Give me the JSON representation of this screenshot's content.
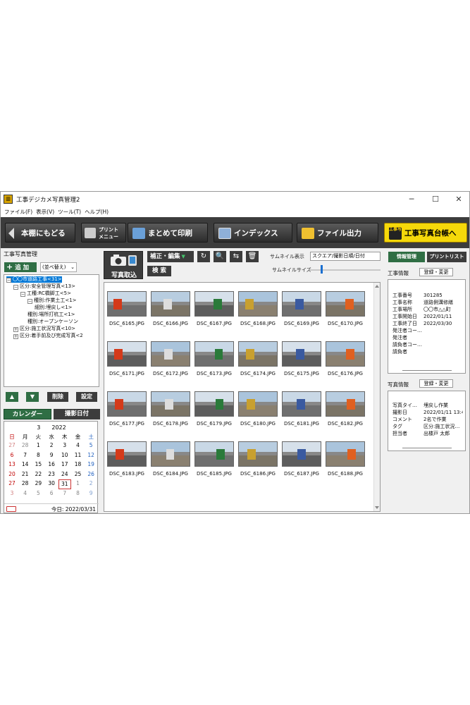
{
  "window": {
    "title": "工事デジカメ写真管理2",
    "minimize": "─",
    "maximize": "☐",
    "close": "✕"
  },
  "menu": [
    "ファイル(F)",
    "表示(V)",
    "ツール(T)",
    "ヘルプ(H)"
  ],
  "toolbar": {
    "back": "本棚にもどる",
    "print_menu_line1": "プリント",
    "print_menu_line2": "メニュー",
    "bulk_print": "まとめて印刷",
    "index": "インデックス",
    "file_output": "ファイル出力",
    "ledger": "工事写真台帳へ",
    "ledger_icon_text": "工事写真"
  },
  "left": {
    "section_title": "工事写真管理",
    "add_button": "追 加",
    "sort_select": "(並べ替え)",
    "tree": [
      {
        "label": "〇〇市道路工事<31>",
        "indent": 0,
        "toggle": "⊟",
        "selected": true
      },
      {
        "label": "区分:安全管理写真<13>",
        "indent": 1,
        "toggle": "⊟"
      },
      {
        "label": "工種:RC橋脚工<5>",
        "indent": 2,
        "toggle": "⊟"
      },
      {
        "label": "種別:作業土工<1>",
        "indent": 3,
        "toggle": "⊟"
      },
      {
        "label": "細別:埋戻し<1>",
        "indent": 4,
        "toggle": ""
      },
      {
        "label": "種別:場所打杭工<1>",
        "indent": 3,
        "toggle": ""
      },
      {
        "label": "種別:オープンケーソン",
        "indent": 3,
        "toggle": ""
      },
      {
        "label": "区分:施工状況写真<10>",
        "indent": 1,
        "toggle": "⊞"
      },
      {
        "label": "区分:着手前及び完成写真<2",
        "indent": 1,
        "toggle": "⊞"
      }
    ],
    "up_button": "▲",
    "down_button": "▼",
    "delete_button": "削除",
    "settings_button": "設定",
    "calendar_tab": "カレンダー",
    "shoot_date_tab": "撮影日付",
    "calendar": {
      "month": "3",
      "year": "2022",
      "weekdays": [
        "日",
        "月",
        "火",
        "水",
        "木",
        "金",
        "土"
      ],
      "weeks": [
        [
          "27",
          "28",
          "1",
          "2",
          "3",
          "4",
          "5"
        ],
        [
          "6",
          "7",
          "8",
          "9",
          "10",
          "11",
          "12"
        ],
        [
          "13",
          "14",
          "15",
          "16",
          "17",
          "18",
          "19"
        ],
        [
          "20",
          "21",
          "22",
          "23",
          "24",
          "25",
          "26"
        ],
        [
          "27",
          "28",
          "29",
          "30",
          "31",
          "1",
          "2"
        ],
        [
          "3",
          "4",
          "5",
          "6",
          "7",
          "8",
          "9"
        ]
      ],
      "today_label": "今日: 2022/03/31"
    }
  },
  "middle": {
    "import_button": "写真取込",
    "edit_button": "補正・編集",
    "search_button": "検 索",
    "thumb_mode_label": "サムネイル表示",
    "thumb_mode_value": "スクエア/撮影日順/日付",
    "thumb_size_label": "サムネイルサイズ",
    "thumb_size_level": 0.15,
    "thumbnails": [
      "DSC_6165.JPG",
      "DSC_6166.JPG",
      "DSC_6167.JPG",
      "DSC_6168.JPG",
      "DSC_6169.JPG",
      "DSC_6170.JPG",
      "DSC_6171.JPG",
      "DSC_6172.JPG",
      "DSC_6173.JPG",
      "DSC_6174.JPG",
      "DSC_6175.JPG",
      "DSC_6176.JPG",
      "DSC_6177.JPG",
      "DSC_6178.JPG",
      "DSC_6179.JPG",
      "DSC_6180.JPG",
      "DSC_6181.JPG",
      "DSC_6182.JPG",
      "DSC_6183.JPG",
      "DSC_6184.JPG",
      "DSC_6185.JPG",
      "DSC_6186.JPG",
      "DSC_6187.JPG",
      "DSC_6188.JPG"
    ]
  },
  "right": {
    "tab_info": "情報管理",
    "tab_printlist": "プリントリスト",
    "work_info_title": "工事情報",
    "work_info_button": "登録・変更",
    "work_info": [
      {
        "k": "工事番号",
        "v": "301285"
      },
      {
        "k": "工事名称",
        "v": "道路側溝修繕"
      },
      {
        "k": "工事場所",
        "v": "〇〇市△△町"
      },
      {
        "k": "工事開始日",
        "v": "2022/01/11"
      },
      {
        "k": "工事終了日",
        "v": "2022/03/30"
      },
      {
        "k": "発注者コー…",
        "v": ""
      },
      {
        "k": "発注者",
        "v": ""
      },
      {
        "k": "請負者コー…",
        "v": ""
      },
      {
        "k": "請負者",
        "v": ""
      }
    ],
    "photo_info_title": "写真情報",
    "photo_info_button": "登録・変更",
    "photo_info": [
      {
        "k": "写真タイ…",
        "v": "埋戻し作業"
      },
      {
        "k": "撮影日",
        "v": "2022/01/11 13:4"
      },
      {
        "k": "コメント",
        "v": "2名で作業"
      },
      {
        "k": "タグ",
        "v": "区分:施工状況…"
      },
      {
        "k": "担当者",
        "v": "出楼戸 太郎"
      }
    ]
  },
  "colors": {
    "toolbar_bg": "#3c3c3c",
    "accent_green": "#2f6e44",
    "ledger_yellow": "#f5d80a",
    "selection_blue": "#0078d7"
  }
}
